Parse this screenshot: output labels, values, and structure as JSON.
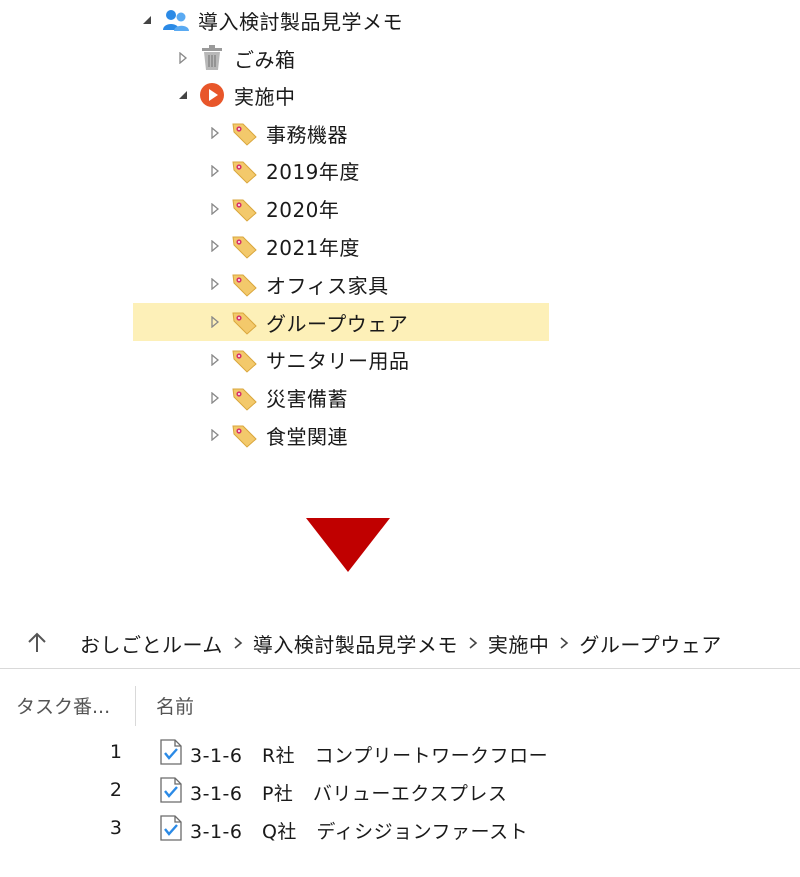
{
  "tree": {
    "root": {
      "label": "導入検討製品見学メモ"
    },
    "trash": {
      "label": "ごみ箱"
    },
    "active": {
      "label": "実施中"
    },
    "items": [
      {
        "label": "事務機器"
      },
      {
        "label": "2019年度"
      },
      {
        "label": "2020年"
      },
      {
        "label": "2021年度"
      },
      {
        "label": "オフィス家具"
      },
      {
        "label": "グループウェア"
      },
      {
        "label": "サニタリー用品"
      },
      {
        "label": "災害備蓄"
      },
      {
        "label": "食堂関連"
      }
    ],
    "selected_index": 5
  },
  "breadcrumb": {
    "items": [
      "おしごとルーム",
      "導入検討製品見学メモ",
      "実施中",
      "グループウェア"
    ],
    "separator": ">"
  },
  "list": {
    "columns": [
      "タスク番...",
      "名前"
    ],
    "rows": [
      {
        "number": "1",
        "name": "3-1-6　R社　コンプリートワークフロー"
      },
      {
        "number": "2",
        "name": "3-1-6　P社　バリューエクスプレス"
      },
      {
        "number": "3",
        "name": "3-1-6　Q社　ディシジョンファースト"
      }
    ]
  },
  "colors": {
    "highlight": "#fdf0b8",
    "arrow": "#c00000",
    "play_icon": "#e8562a",
    "user_icon": "#2b8ae6",
    "tag_icon": "#f3c96b"
  },
  "icons": {
    "root": "users-icon",
    "trash": "trash-icon",
    "active": "play-circle-icon",
    "items": "tag-icon",
    "up": "up-arrow-icon",
    "doc": "checked-document-icon"
  }
}
